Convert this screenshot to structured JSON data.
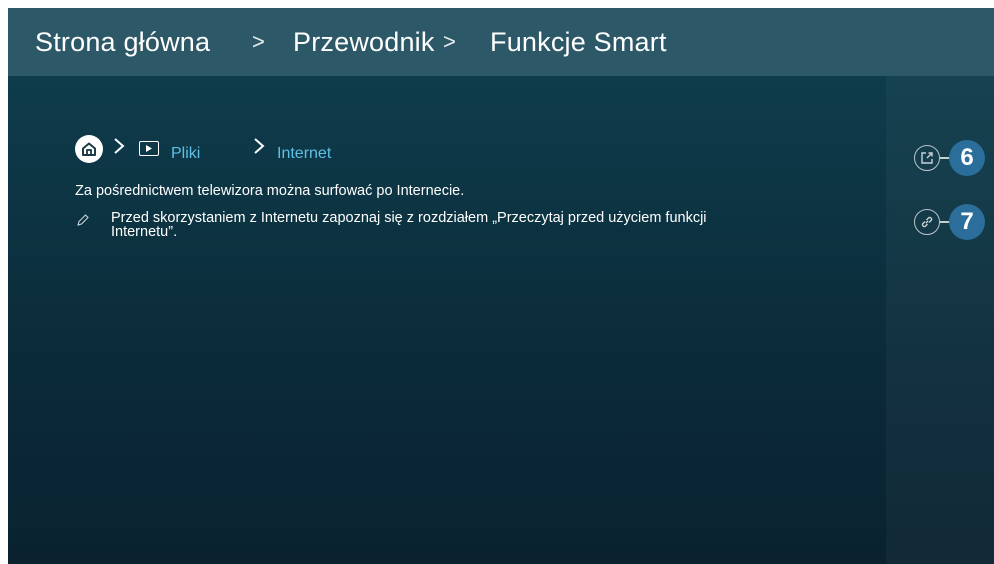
{
  "header": {
    "crumbs": [
      "Strona główna",
      "Przewodnik",
      "Funkcje Smart"
    ],
    "separator": ">"
  },
  "nav": {
    "home_icon": "home-icon",
    "media_icon": "media-play-icon",
    "items": [
      "Pliki",
      "Internet"
    ]
  },
  "content": {
    "description": "Za pośrednictwem telewizora można surfować po Internecie.",
    "note": "Przed skorzystaniem z Internetu zapoznaj się z rozdziałem „Przeczytaj przed użyciem funkcji Internetu”.",
    "note_icon": "pencil-icon"
  },
  "actions": [
    {
      "icon": "external-link-icon",
      "badge": "6"
    },
    {
      "icon": "link-icon",
      "badge": "7"
    }
  ],
  "colors": {
    "header_bg": "#2c5867",
    "screen_bg": "#0d3645",
    "link": "#5fc0e6",
    "badge_bg": "#2b6e9b"
  }
}
